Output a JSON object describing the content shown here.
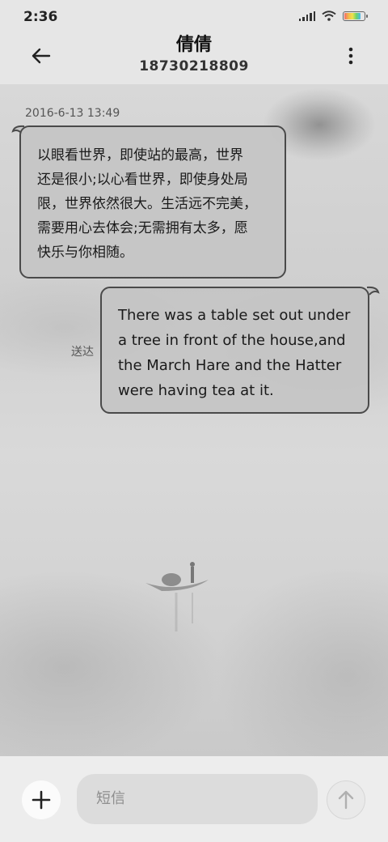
{
  "status_bar": {
    "time": "2:36",
    "icons": [
      "signal-icon",
      "wifi-icon",
      "battery-icon"
    ]
  },
  "header": {
    "back_icon": "arrow-left-icon",
    "contact_name": "倩倩",
    "contact_phone": "18730218809",
    "more_icon": "more-vertical-icon"
  },
  "conversation": {
    "timestamp": "2016-6-13 13:49",
    "messages": [
      {
        "direction": "incoming",
        "lines": [
          "以眼看世界，即使站的最高，世界",
          "还是很小;以心看世界，即使身处局",
          "限，世界依然很大。生活远不完美，",
          "需要用心去体会;无需拥有太多，愿",
          "快乐与你相随。"
        ]
      },
      {
        "direction": "outgoing",
        "status": "送达",
        "lines": [
          "There was a table set out under",
          "a tree in front of the house,and",
          "the March Hare and the Hatter",
          "were having tea at it."
        ]
      }
    ]
  },
  "input_bar": {
    "add_icon": "plus-icon",
    "placeholder": "短信",
    "send_icon": "arrow-up-icon"
  }
}
